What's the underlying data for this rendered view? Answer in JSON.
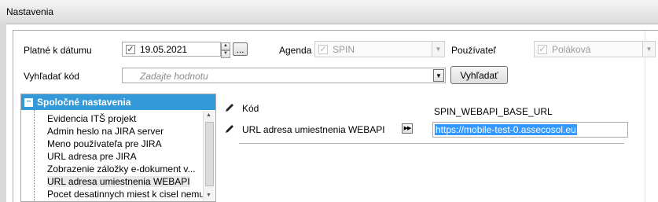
{
  "window": {
    "title": "Nastavenia"
  },
  "filters": {
    "date_label": "Platné k dátumu",
    "date_value": "19.05.2021",
    "date_checked": "✓",
    "date_picker_label": "...",
    "agenda_label": "Agenda",
    "agenda_value": "SPIN",
    "agenda_checked": "✓",
    "user_label": "Používateľ",
    "user_value": "Poláková",
    "user_checked": "✓",
    "search_label": "Vyhľadať kód",
    "search_placeholder": "Zadajte hodnotu",
    "search_button": "Vyhľadať"
  },
  "tree": {
    "group_label": "Spoločné nastavenia",
    "items": [
      {
        "label": "Evidencia ITŠ projekt"
      },
      {
        "label": "Admin heslo na JIRA server"
      },
      {
        "label": "Meno používateľa pre JIRA"
      },
      {
        "label": "URL adresa pre JIRA"
      },
      {
        "label": "Zobrazenie záložky e-dokument v..."
      },
      {
        "label": "URL adresa umiestnenia WEBAPI"
      },
      {
        "label": "Pocet desatinnych miest  k cisel nemu..."
      }
    ],
    "selected_index": 5
  },
  "detail": {
    "code_label": "Kód",
    "code_value": "SPIN_WEBAPI_BASE_URL",
    "name_label": "URL adresa umiestnenia WEBAPI",
    "value": "https://mobile-test-0.assecosol.eu"
  },
  "colors": {
    "accent": "#3399d8",
    "selection": "#3399ff"
  }
}
